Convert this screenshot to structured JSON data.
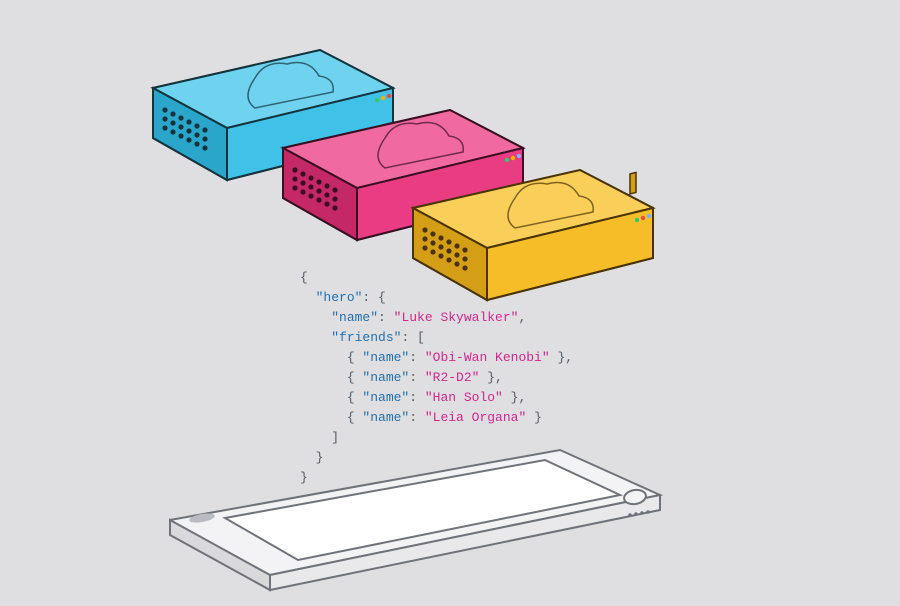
{
  "diagram": {
    "servers": [
      {
        "color": "cyan",
        "fill": "#3fc1e8",
        "shade": "#2aa6cb"
      },
      {
        "color": "magenta",
        "fill": "#ea3c82",
        "shade": "#c42867"
      },
      {
        "color": "yellow",
        "fill": "#f5bd27",
        "shade": "#d49f17"
      }
    ],
    "phone": {
      "label": "client-phone"
    }
  },
  "payload": {
    "root_open": "{",
    "hero_key": "\"hero\"",
    "hero_open": ": {",
    "name_key": "\"name\"",
    "name_value": "\"Luke Skywalker\"",
    "friends_key": "\"friends\"",
    "friends_open": ": [",
    "friends": [
      {
        "key": "\"name\"",
        "value": "\"Obi-Wan Kenobi\""
      },
      {
        "key": "\"name\"",
        "value": "\"R2-D2\""
      },
      {
        "key": "\"name\"",
        "value": "\"Han Solo\""
      },
      {
        "key": "\"name\"",
        "value": "\"Leia Organa\""
      }
    ],
    "friends_close": "]",
    "hero_close": "}",
    "root_close": "}"
  }
}
